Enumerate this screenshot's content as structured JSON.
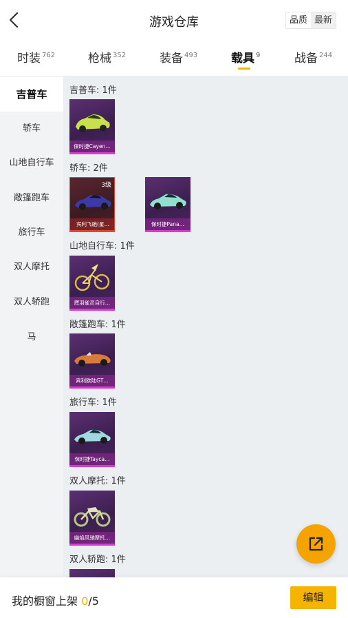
{
  "header": {
    "title": "游戏仓库",
    "sort_options": [
      "品质",
      "最新"
    ]
  },
  "tabs": [
    {
      "label": "时装",
      "count": "762"
    },
    {
      "label": "枪械",
      "count": "352"
    },
    {
      "label": "装备",
      "count": "493"
    },
    {
      "label": "载具",
      "count": "9"
    },
    {
      "label": "战备",
      "count": "244"
    }
  ],
  "active_tab": "载具",
  "sidebar": {
    "items": [
      "吉普车",
      "轿车",
      "山地自行车",
      "敞篷跑车",
      "旅行车",
      "双人摩托",
      "双人轿跑",
      "马"
    ]
  },
  "sections": [
    {
      "title": "吉普车: 1件",
      "items": [
        {
          "name": "保时捷Cayen…"
        }
      ]
    },
    {
      "title": "轿车: 2件",
      "items": [
        {
          "name": "宾利飞驰(星…",
          "level": "3级"
        },
        {
          "name": "保时捷Pana…"
        }
      ]
    },
    {
      "title": "山地自行车: 1件",
      "items": [
        {
          "name": "辉羽雀灵自行…"
        }
      ]
    },
    {
      "title": "敞篷跑车: 1件",
      "items": [
        {
          "name": "宾利欧陆GT…"
        }
      ]
    },
    {
      "title": "旅行车: 1件",
      "items": [
        {
          "name": "保时捷Tayca…"
        }
      ]
    },
    {
      "title": "双人摩托: 1件",
      "items": [
        {
          "name": "幽焰风驰摩托…"
        }
      ]
    },
    {
      "title": "双人轿跑: 1件",
      "items": []
    }
  ],
  "bottom": {
    "shelf_label": "我的橱窗上架",
    "shelf_used": "0",
    "shelf_total": "/5",
    "edit_label": "编辑"
  },
  "colors": {
    "accent": "#f5b400",
    "card_purple": "#d53ccf",
    "card_red": "#e0482e"
  },
  "icons": {
    "back": "chevron-left-icon",
    "share": "external-link-icon"
  }
}
